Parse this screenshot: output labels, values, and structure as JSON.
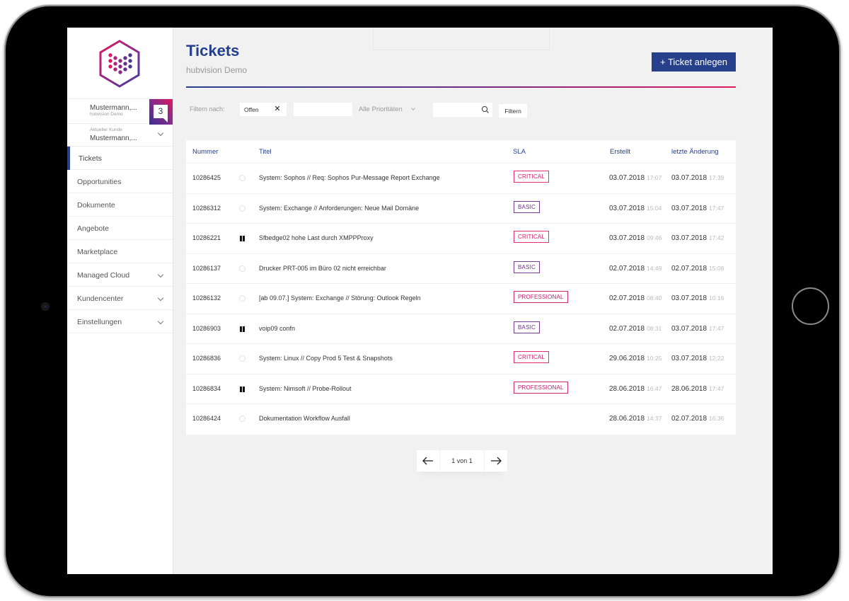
{
  "app": {
    "brand": "hubvision",
    "colors": {
      "primary": "#27408b",
      "accent": "#e0175f",
      "purple": "#6b2c86",
      "critical": "#d9186a",
      "basic": "#6f2f8f",
      "professional": "#c21968"
    }
  },
  "sidebar": {
    "logo_icon": "hexagon-dots-logo",
    "user": {
      "name": "Mustermann,...",
      "company": "hubvision Demo",
      "notification_count": "3"
    },
    "customer": {
      "label": "Aktueller Kunde",
      "name": "Mustermann,..."
    },
    "items": [
      {
        "label": "Tickets",
        "active": true,
        "expandable": false
      },
      {
        "label": "Opportunities",
        "active": false,
        "expandable": false
      },
      {
        "label": "Dokumente",
        "active": false,
        "expandable": false
      },
      {
        "label": "Angebote",
        "active": false,
        "expandable": false
      },
      {
        "label": "Marketplace",
        "active": false,
        "expandable": false
      },
      {
        "label": "Managed Cloud",
        "active": false,
        "expandable": true
      },
      {
        "label": "Kundencenter",
        "active": false,
        "expandable": true
      },
      {
        "label": "Einstellungen",
        "active": false,
        "expandable": true
      }
    ]
  },
  "header": {
    "title": "Tickets",
    "subtitle": "hubvision Demo",
    "new_ticket_label": "+ Ticket anlegen"
  },
  "filters": {
    "label": "Filtern nach:",
    "status_chip": "Offen",
    "chip_remove_icon": "close-icon",
    "text_value": "",
    "priority_select": "Alle Prioritäten",
    "search_value": "",
    "search_icon": "search-icon",
    "submit_label": "Filtern"
  },
  "table": {
    "columns": [
      "Nummer",
      "",
      "Titel",
      "SLA",
      "Erstellt",
      "letzte Änderung"
    ],
    "rows": [
      {
        "number": "10286425",
        "status": "open",
        "title": "System: Sophos // Req: Sophos Pur-Message Report Exchange",
        "sla": "CRITICAL",
        "created_date": "03.07.2018",
        "created_time": "17:07",
        "changed_date": "03.07.2018",
        "changed_time": "17:39"
      },
      {
        "number": "10286312",
        "status": "open",
        "title": "System: Exchange // Anforderungen: Neue Mail Domäne",
        "sla": "BASIC",
        "created_date": "03.07.2018",
        "created_time": "15:04",
        "changed_date": "03.07.2018",
        "changed_time": "17:47"
      },
      {
        "number": "10286221",
        "status": "paused",
        "title": "Sfbedge02 hohe Last durch XMPPProxy",
        "sla": "CRITICAL",
        "created_date": "03.07.2018",
        "created_time": "09:46",
        "changed_date": "03.07.2018",
        "changed_time": "17:42"
      },
      {
        "number": "10286137",
        "status": "open",
        "title": "Drucker PRT-005 im Büro 02 nicht erreichbar",
        "sla": "BASIC",
        "created_date": "02.07.2018",
        "created_time": "14:49",
        "changed_date": "02.07.2018",
        "changed_time": "15:08"
      },
      {
        "number": "10286132",
        "status": "open",
        "title": "[ab 09.07.] System: Exchange // Störung: Outlook Regeln",
        "sla": "PROFESSIONAL",
        "created_date": "02.07.2018",
        "created_time": "08:40",
        "changed_date": "03.07.2018",
        "changed_time": "10:16"
      },
      {
        "number": "10286903",
        "status": "paused",
        "title": "voip09 confn",
        "sla": "BASIC",
        "created_date": "02.07.2018",
        "created_time": "08:31",
        "changed_date": "03.07.2018",
        "changed_time": "17:47"
      },
      {
        "number": "10286836",
        "status": "open",
        "title": "System: Linux // Copy Prod 5 Test & Snapshots",
        "sla": "CRITICAL",
        "created_date": "29.06.2018",
        "created_time": "10:25",
        "changed_date": "03.07.2018",
        "changed_time": "12:22"
      },
      {
        "number": "10286834",
        "status": "paused",
        "title": "System: Nimsoft // Probe-Rollout",
        "sla": "PROFESSIONAL",
        "created_date": "28.06.2018",
        "created_time": "16:47",
        "changed_date": "28.06.2018",
        "changed_time": "17:47"
      },
      {
        "number": "10286424",
        "status": "open",
        "title": "Dokumentation Workflow Ausfall",
        "sla": "",
        "created_date": "28.06.2018",
        "created_time": "14:37",
        "changed_date": "02.07.2018",
        "changed_time": "16:36"
      }
    ]
  },
  "pagination": {
    "info": "1 von 1",
    "prev_icon": "arrow-left-icon",
    "next_icon": "arrow-right-icon"
  }
}
